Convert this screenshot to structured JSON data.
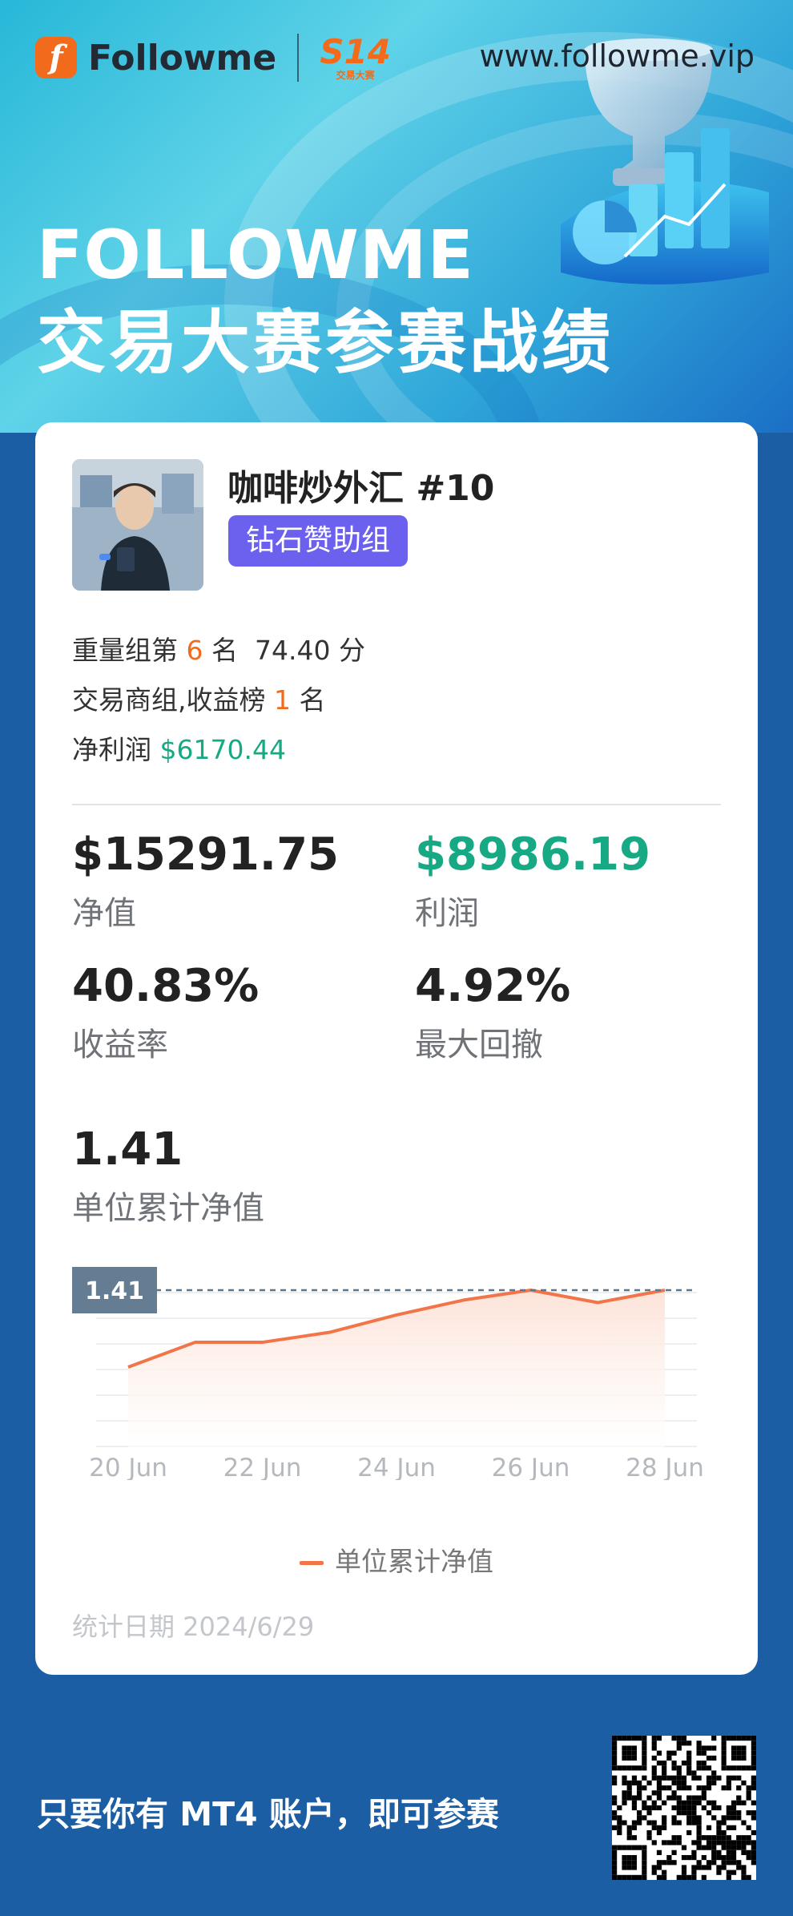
{
  "header": {
    "brand": "Followme",
    "s14_mark": "S14",
    "s14_sub": "交易大赛",
    "url": "www.followme.vip",
    "title_line1": "FOLLOWME",
    "title_line2": "交易大赛参赛战绩"
  },
  "profile": {
    "name": "咖啡炒外汇 #10",
    "group_badge": "钻石赞助组"
  },
  "ranking": {
    "line1_prefix": "重量组第",
    "line1_rank": "6",
    "line1_suffix": "名",
    "line1_score": "74.40 分",
    "line2_prefix": "交易商组,收益榜",
    "line2_rank": "1",
    "line2_suffix": "名",
    "line3_prefix": "净利润",
    "line3_value": "$6170.44"
  },
  "stats": {
    "equity_value": "$15291.75",
    "equity_label": "净值",
    "profit_value": "$8986.19",
    "profit_label": "利润",
    "return_value": "40.83%",
    "return_label": "收益率",
    "drawdown_value": "4.92%",
    "drawdown_label": "最大回撤",
    "nav_value": "1.41",
    "nav_label": "单位累计净值"
  },
  "chart_data": {
    "type": "area",
    "x": [
      "20 Jun",
      "21 Jun",
      "22 Jun",
      "23 Jun",
      "24 Jun",
      "25 Jun",
      "26 Jun",
      "27 Jun",
      "28 Jun"
    ],
    "series": [
      {
        "name": "单位累计净值",
        "values": [
          1.1,
          1.2,
          1.2,
          1.24,
          1.31,
          1.37,
          1.41,
          1.36,
          1.41
        ]
      }
    ],
    "x_tick_labels": [
      "20 Jun",
      "22 Jun",
      "24 Jun",
      "26 Jun",
      "28 Jun"
    ],
    "current_value_label": "1.41",
    "legend": "单位累计净值",
    "colors": {
      "line": "#f2754a",
      "fill": "#fde3d8",
      "reference_line": "#5f7689",
      "value_tag": "#647d93"
    },
    "grid": true
  },
  "footer": {
    "date_label": "统计日期 2024/6/29",
    "slogan": "只要你有 MT4 账户，即可参赛"
  }
}
